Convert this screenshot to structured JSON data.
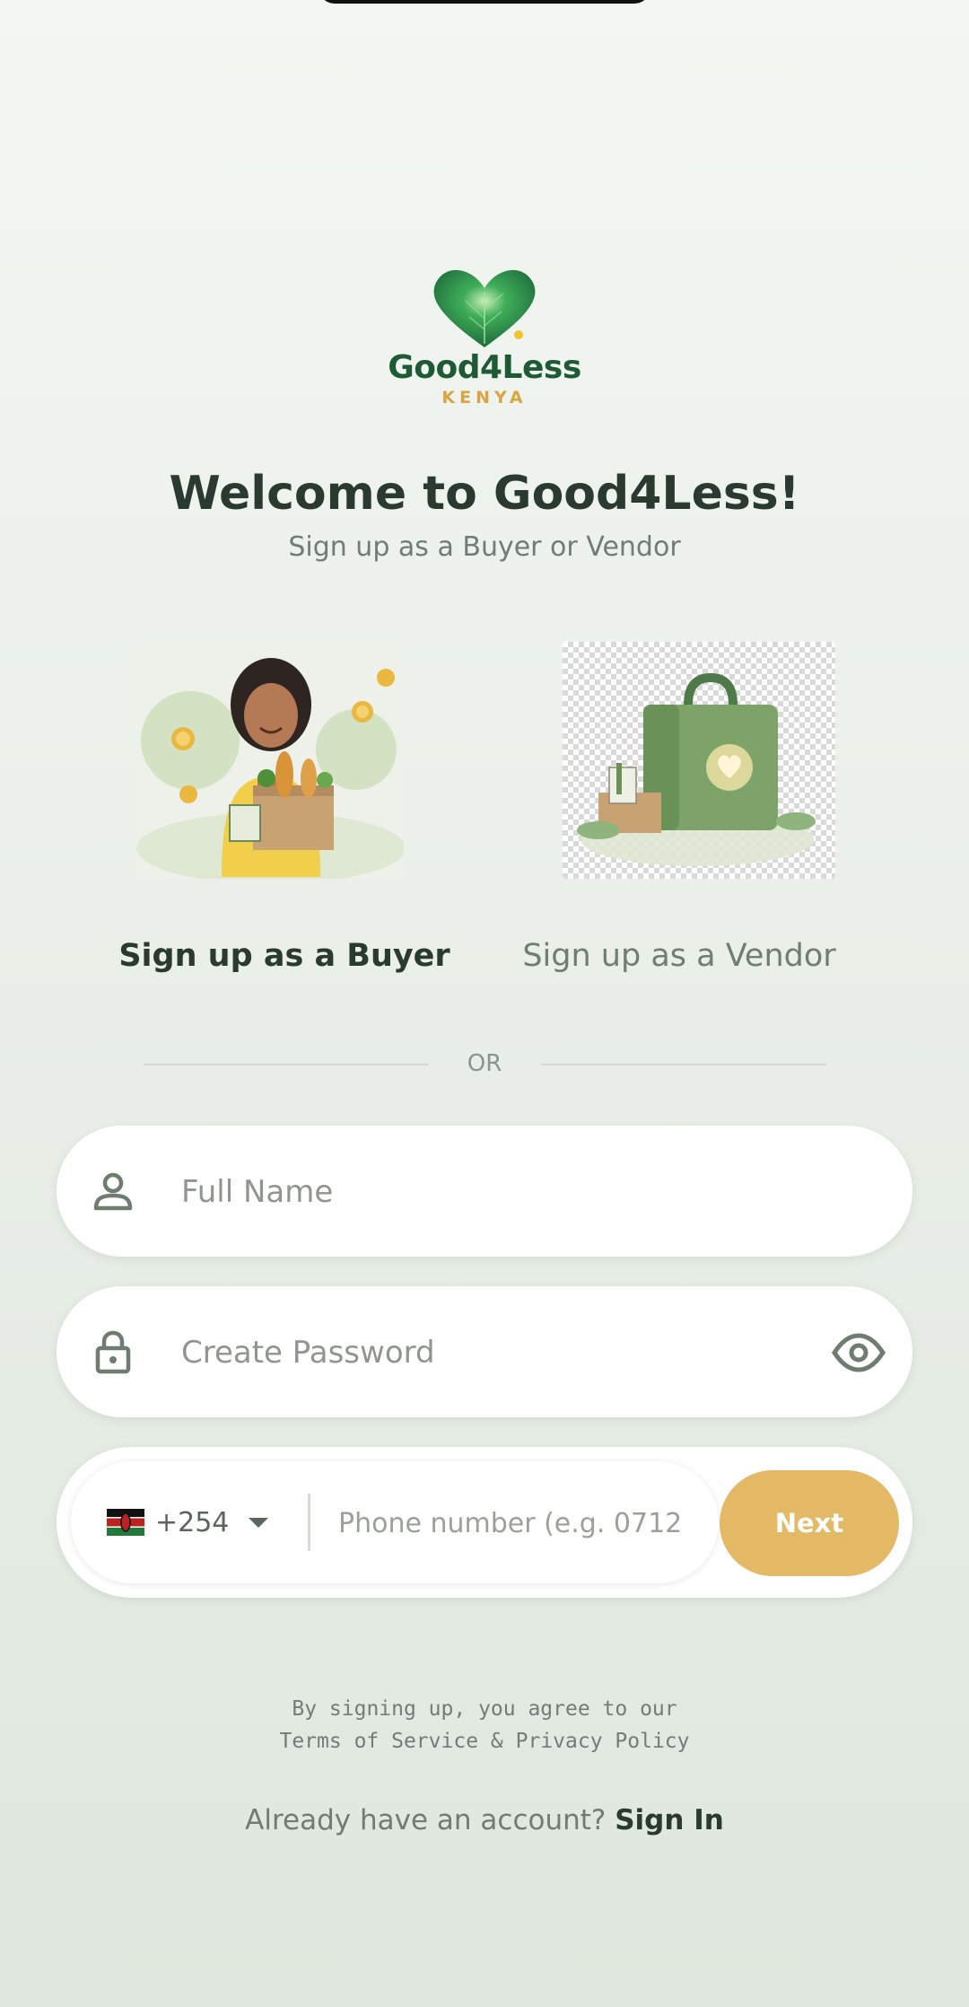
{
  "brand": {
    "name": "Good4Less",
    "country": "KENYA",
    "colors": {
      "primary_green": "#1f5a36",
      "accent_gold": "#e3b965",
      "text_dark": "#2b3a2f"
    }
  },
  "header": {
    "title": "Welcome to Good4Less!",
    "subtitle": "Sign up as a Buyer or Vendor"
  },
  "roles": {
    "buyer_label": "Sign up as a Buyer",
    "vendor_label": "Sign up as a Vendor",
    "selected": "buyer"
  },
  "divider_text": "OR",
  "form": {
    "full_name_placeholder": "Full Name",
    "password_placeholder": "Create Password",
    "country_code": "+254",
    "country_flag": "kenya-flag-icon",
    "phone_placeholder": "Phone number (e.g. 0712",
    "next_label": "Next"
  },
  "footer": {
    "terms_line1": "By signing up, you agree to our",
    "terms_of_service": "Terms of Service",
    "amp": "&",
    "privacy_policy": "Privacy Policy",
    "have_account": "Already have an account?",
    "sign_in": "Sign In"
  },
  "icons": [
    "person-icon",
    "lock-icon",
    "eye-icon",
    "kenya-flag-icon",
    "chevron-down-icon",
    "heart-leaf-logo"
  ]
}
